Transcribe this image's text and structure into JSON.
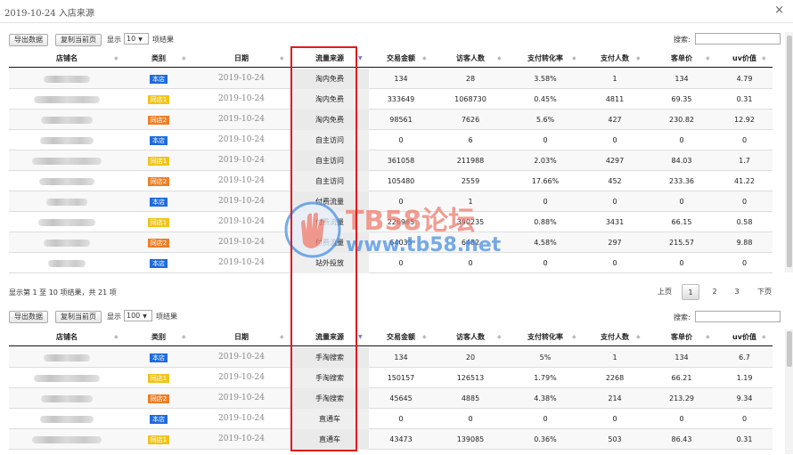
{
  "window": {
    "title_date": "2019-10-24",
    "title_suffix": " 入店来源",
    "close": "×"
  },
  "toolbar": {
    "export": "导出数据",
    "copy": "复制当前页",
    "show": "显示",
    "result_suffix": "项结果",
    "search_label": "搜索:"
  },
  "table1": {
    "page_size": "10"
  },
  "table2": {
    "page_size": "100"
  },
  "columns": [
    "店铺名",
    "类别",
    "日期",
    "流量来源",
    "交易金额",
    "访客人数",
    "支付转化率",
    "支付人数",
    "客单价",
    "uv价值"
  ],
  "rows1": [
    {
      "cat": "本店",
      "color": "blue",
      "date": "2019-10-24",
      "source": "淘内免费",
      "amount": "134",
      "visitors": "28",
      "conv": "3.58%",
      "payers": "1",
      "aov": "134",
      "uv": "4.79"
    },
    {
      "cat": "同店1",
      "color": "yellow",
      "date": "2019-10-24",
      "source": "淘内免费",
      "amount": "333649",
      "visitors": "1068730",
      "conv": "0.45%",
      "payers": "4811",
      "aov": "69.35",
      "uv": "0.31"
    },
    {
      "cat": "同店2",
      "color": "orange",
      "date": "2019-10-24",
      "source": "淘内免费",
      "amount": "98561",
      "visitors": "7626",
      "conv": "5.6%",
      "payers": "427",
      "aov": "230.82",
      "uv": "12.92"
    },
    {
      "cat": "本店",
      "color": "blue",
      "date": "2019-10-24",
      "source": "自主访问",
      "amount": "0",
      "visitors": "6",
      "conv": "0",
      "payers": "0",
      "aov": "0",
      "uv": "0"
    },
    {
      "cat": "同店1",
      "color": "yellow",
      "date": "2019-10-24",
      "source": "自主访问",
      "amount": "361058",
      "visitors": "211988",
      "conv": "2.03%",
      "payers": "4297",
      "aov": "84.03",
      "uv": "1.7"
    },
    {
      "cat": "同店2",
      "color": "orange",
      "date": "2019-10-24",
      "source": "自主访问",
      "amount": "105480",
      "visitors": "2559",
      "conv": "17.66%",
      "payers": "452",
      "aov": "233.36",
      "uv": "41.22"
    },
    {
      "cat": "本店",
      "color": "blue",
      "date": "2019-10-24",
      "source": "付费流量",
      "amount": "0",
      "visitors": "1",
      "conv": "0",
      "payers": "0",
      "aov": "0",
      "uv": "0"
    },
    {
      "cat": "同店1",
      "color": "yellow",
      "date": "2019-10-24",
      "source": "付费流量",
      "amount": "226965",
      "visitors": "390235",
      "conv": "0.88%",
      "payers": "3431",
      "aov": "66.15",
      "uv": "0.58"
    },
    {
      "cat": "同店2",
      "color": "orange",
      "date": "2019-10-24",
      "source": "付费流量",
      "amount": "64035",
      "visitors": "6482",
      "conv": "4.58%",
      "payers": "297",
      "aov": "215.57",
      "uv": "9.88"
    },
    {
      "cat": "本店",
      "color": "blue",
      "date": "2019-10-24",
      "source": "站外投放",
      "amount": "0",
      "visitors": "0",
      "conv": "0",
      "payers": "0",
      "aov": "0",
      "uv": "0"
    }
  ],
  "info": "显示第 1 至 10 项结果，共 21 项",
  "pager": {
    "prev": "上页",
    "pages": [
      "1",
      "2",
      "3"
    ],
    "next": "下页",
    "current": "1"
  },
  "rows2": [
    {
      "cat": "本店",
      "color": "blue",
      "date": "2019-10-24",
      "source": "手淘搜索",
      "amount": "134",
      "visitors": "20",
      "conv": "5%",
      "payers": "1",
      "aov": "134",
      "uv": "6.7"
    },
    {
      "cat": "同店1",
      "color": "yellow",
      "date": "2019-10-24",
      "source": "手淘搜索",
      "amount": "150157",
      "visitors": "126513",
      "conv": "1.79%",
      "payers": "2268",
      "aov": "66.21",
      "uv": "1.19"
    },
    {
      "cat": "同店2",
      "color": "orange",
      "date": "2019-10-24",
      "source": "手淘搜索",
      "amount": "45645",
      "visitors": "4885",
      "conv": "4.38%",
      "payers": "214",
      "aov": "213.29",
      "uv": "9.34"
    },
    {
      "cat": "本店",
      "color": "blue",
      "date": "2019-10-24",
      "source": "直通车",
      "amount": "0",
      "visitors": "0",
      "conv": "0",
      "payers": "0",
      "aov": "0",
      "uv": "0"
    },
    {
      "cat": "同店1",
      "color": "yellow",
      "date": "2019-10-24",
      "source": "直通车",
      "amount": "43473",
      "visitors": "139085",
      "conv": "0.36%",
      "payers": "503",
      "aov": "86.43",
      "uv": "0.31"
    }
  ],
  "watermark": {
    "line1": "TB58论坛",
    "line2": "www.tb58.net"
  }
}
